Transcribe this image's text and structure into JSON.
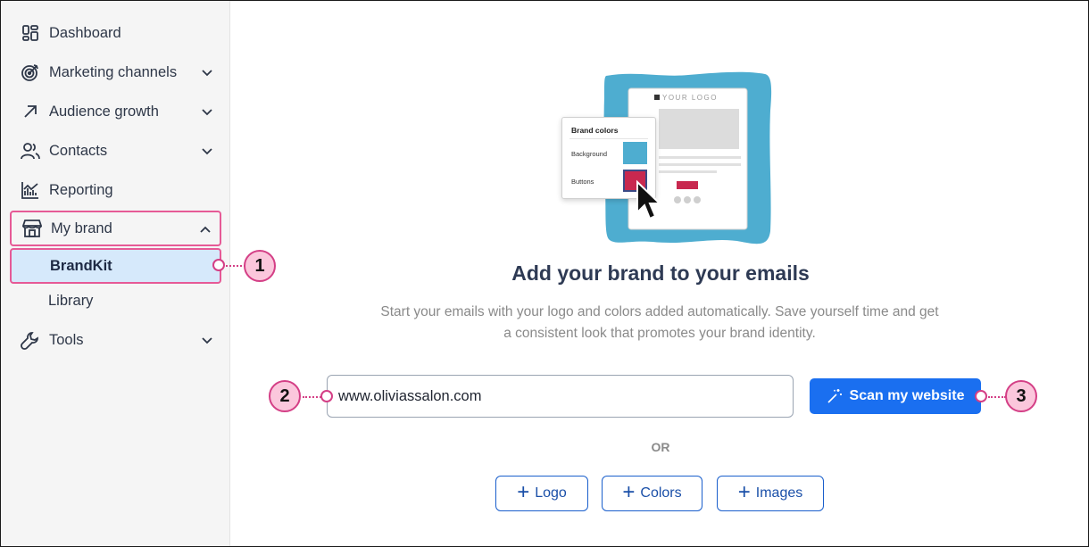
{
  "sidebar": {
    "items": [
      {
        "label": "Dashboard",
        "icon": "dashboard-icon"
      },
      {
        "label": "Marketing channels",
        "icon": "target-icon"
      },
      {
        "label": "Audience growth",
        "icon": "arrow-up-right-icon"
      },
      {
        "label": "Contacts",
        "icon": "people-icon"
      },
      {
        "label": "Reporting",
        "icon": "chart-icon"
      },
      {
        "label": "My brand",
        "icon": "storefront-icon"
      },
      {
        "label": "Tools",
        "icon": "wrench-icon"
      }
    ],
    "subitems": [
      {
        "label": "BrandKit",
        "active": true
      },
      {
        "label": "Library",
        "active": false
      }
    ]
  },
  "illustration": {
    "logo_text": "YOUR LOGO",
    "card_title": "Brand colors",
    "background_label": "Background",
    "buttons_label": "Buttons",
    "background_color": "#4ba9cf",
    "buttons_color": "#c8284f"
  },
  "main": {
    "title": "Add your brand to your emails",
    "description": "Start your emails with your logo and colors added automatically. Save yourself time and get a consistent look that promotes your brand identity.",
    "url_value": "www.oliviassalon.com",
    "scan_button": "Scan my website",
    "or_label": "OR",
    "add_buttons": [
      "Logo",
      "Colors",
      "Images"
    ]
  },
  "callouts": [
    "1",
    "2",
    "3"
  ],
  "colors": {
    "accent": "#1a6ff0",
    "highlight": "#e65a96",
    "active_bg": "#d6e9fb"
  }
}
